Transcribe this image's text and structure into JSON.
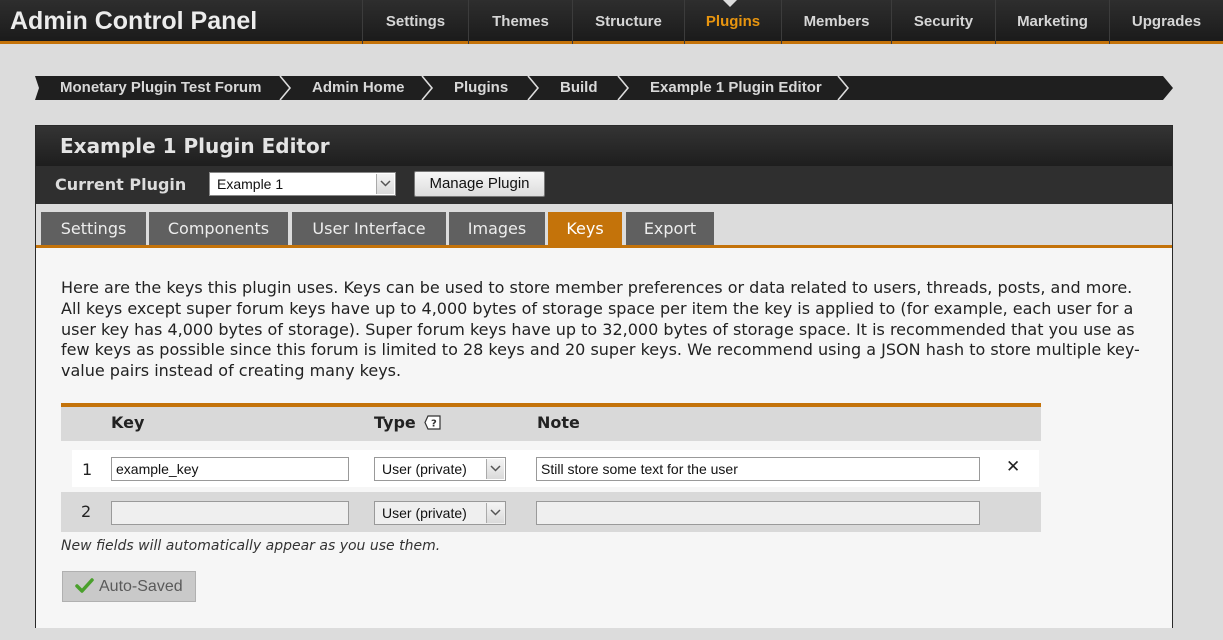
{
  "app": {
    "title": "Admin Control Panel"
  },
  "nav": [
    {
      "label": "Settings",
      "active": false
    },
    {
      "label": "Themes",
      "active": false
    },
    {
      "label": "Structure",
      "active": false
    },
    {
      "label": "Plugins",
      "active": true
    },
    {
      "label": "Members",
      "active": false
    },
    {
      "label": "Security",
      "active": false
    },
    {
      "label": "Marketing",
      "active": false
    },
    {
      "label": "Upgrades",
      "active": false
    }
  ],
  "breadcrumb": [
    "Monetary Plugin Test Forum",
    "Admin Home",
    "Plugins",
    "Build",
    "Example 1 Plugin Editor"
  ],
  "panel": {
    "title": "Example 1 Plugin Editor",
    "current_plugin_label": "Current Plugin",
    "current_plugin_value": "Example 1",
    "manage_button": "Manage Plugin"
  },
  "tabs": [
    {
      "label": "Settings",
      "active": false
    },
    {
      "label": "Components",
      "active": false
    },
    {
      "label": "User Interface",
      "active": false
    },
    {
      "label": "Images",
      "active": false
    },
    {
      "label": "Keys",
      "active": true
    },
    {
      "label": "Export",
      "active": false
    }
  ],
  "description": "Here are the keys this plugin uses. Keys can be used to store member preferences or data related to users, threads, posts, and more. All keys except super forum keys have up to 4,000 bytes of storage space per item the key is applied to (for example, each user for a user key has 4,000 bytes of storage). Super forum keys have up to 32,000 bytes of storage space. It is recommended that you use as few keys as possible since this forum is limited to 28 keys and 20 super keys. We recommend using a JSON hash to store multiple key-value pairs instead of creating many keys.",
  "table": {
    "headers": {
      "key": "Key",
      "type": "Type",
      "note": "Note"
    },
    "rows": [
      {
        "num": "1",
        "key": "example_key",
        "type": "User (private)",
        "note": "Still store some text for the user",
        "deletable": true
      },
      {
        "num": "2",
        "key": "",
        "type": "User (private)",
        "note": "",
        "deletable": false
      }
    ],
    "delete_icon": "✕"
  },
  "hint": "New fields will automatically appear as you use them.",
  "autosave_label": "Auto-Saved",
  "colors": {
    "accent": "#c4730a",
    "active_nav": "#e8950f",
    "dark": "#1f1f1f"
  }
}
